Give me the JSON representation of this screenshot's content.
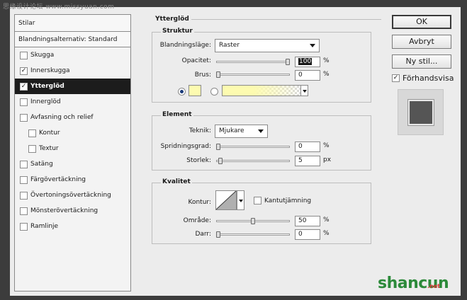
{
  "watermark_top": "思缘设计论坛  www.missyuan.com",
  "sidebar": {
    "header": "Stilar",
    "blend_options": "Blandningsalternativ: Standard",
    "items": [
      {
        "label": "Skugga",
        "checked": false,
        "indent": false,
        "selected": false
      },
      {
        "label": "Innerskugga",
        "checked": true,
        "indent": false,
        "selected": false
      },
      {
        "label": "Ytterglöd",
        "checked": true,
        "indent": false,
        "selected": true
      },
      {
        "label": "Innerglöd",
        "checked": false,
        "indent": false,
        "selected": false
      },
      {
        "label": "Avfasning och relief",
        "checked": false,
        "indent": false,
        "selected": false
      },
      {
        "label": "Kontur",
        "checked": false,
        "indent": true,
        "selected": false
      },
      {
        "label": "Textur",
        "checked": false,
        "indent": true,
        "selected": false
      },
      {
        "label": "Satäng",
        "checked": false,
        "indent": false,
        "selected": false
      },
      {
        "label": "Färgövertäckning",
        "checked": false,
        "indent": false,
        "selected": false
      },
      {
        "label": "Övertoningsövertäckning",
        "checked": false,
        "indent": false,
        "selected": false
      },
      {
        "label": "Mönsterövertäckning",
        "checked": false,
        "indent": false,
        "selected": false
      },
      {
        "label": "Ramlinje",
        "checked": false,
        "indent": false,
        "selected": false
      }
    ]
  },
  "panel_title": "Ytterglöd",
  "struktur": {
    "title": "Struktur",
    "blend_mode_label": "Blandningsläge:",
    "blend_mode_value": "Raster",
    "opacity_label": "Opacitet:",
    "opacity_value": "100",
    "opacity_percent": 100,
    "noise_label": "Brus:",
    "noise_value": "0",
    "noise_percent": 0,
    "unit_percent": "%",
    "color_swatch": "#fdfbb0",
    "gradient_start": "#fdfbb0"
  },
  "element": {
    "title": "Element",
    "technique_label": "Teknik:",
    "technique_value": "Mjukare",
    "spread_label": "Spridningsgrad:",
    "spread_value": "0",
    "spread_percent": 0,
    "size_label": "Storlek:",
    "size_value": "5",
    "size_unit": "px",
    "unit_percent": "%"
  },
  "kvalitet": {
    "title": "Kvalitet",
    "contour_label": "Kontur:",
    "antialias_label": "Kantutjämning",
    "antialias_checked": false,
    "range_label": "Område:",
    "range_value": "50",
    "range_percent": 50,
    "jitter_label": "Darr:",
    "jitter_value": "0",
    "jitter_percent": 0,
    "unit_percent": "%"
  },
  "buttons": {
    "ok": "OK",
    "cancel": "Avbryt",
    "new_style": "Ny stil...",
    "preview_label": "Förhandsvisa",
    "preview_checked": true
  },
  "watermark": {
    "text": "shancun",
    "sub": ".net"
  }
}
